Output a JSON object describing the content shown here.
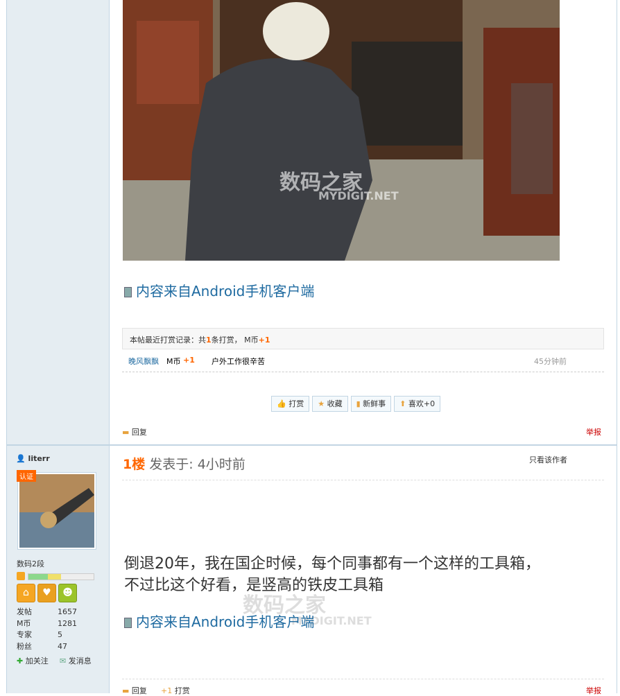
{
  "post_top": {
    "mobile_label": "内容来自Android手机客户端",
    "rate_summary": {
      "prefix": "本帖最近打赏记录：共",
      "count": "1",
      "mid": "条打赏， M币",
      "total": "+1"
    },
    "rate_entry": {
      "user": "晚风飘飘",
      "currency": "M币",
      "amount": "+1",
      "reason": "户外工作很辛苦",
      "time": "45分钟前"
    },
    "actions": [
      "打赏",
      "收藏",
      "新鲜事",
      "喜欢+0"
    ],
    "reply": "回复",
    "report": "举报",
    "watermark": {
      "cn": "数码之家",
      "en": "MYDIGIT.NET"
    }
  },
  "post_1": {
    "username": "literr",
    "badge": "认证",
    "rank": "数码2段",
    "floor": "1楼",
    "posted": "发表于: 4小时前",
    "only_author": "只看该作者",
    "content_line1": "倒退20年，我在国企时候，每个同事都有一个这样的工具箱，",
    "content_line2": "不过比这个好看，是竖高的铁皮工具箱",
    "mobile_label": "内容来自Android手机客户端",
    "stats": [
      {
        "label": "发帖",
        "value": "1657"
      },
      {
        "label": "M币",
        "value": "1281"
      },
      {
        "label": "专家",
        "value": "5"
      },
      {
        "label": "粉丝",
        "value": "47"
      }
    ],
    "follow": "加关注",
    "message": "发消息",
    "reply": "回复",
    "tip": "打赏",
    "report": "举报",
    "watermark": {
      "cn": "数码之家",
      "en": "MYDIGIT.NET"
    }
  }
}
